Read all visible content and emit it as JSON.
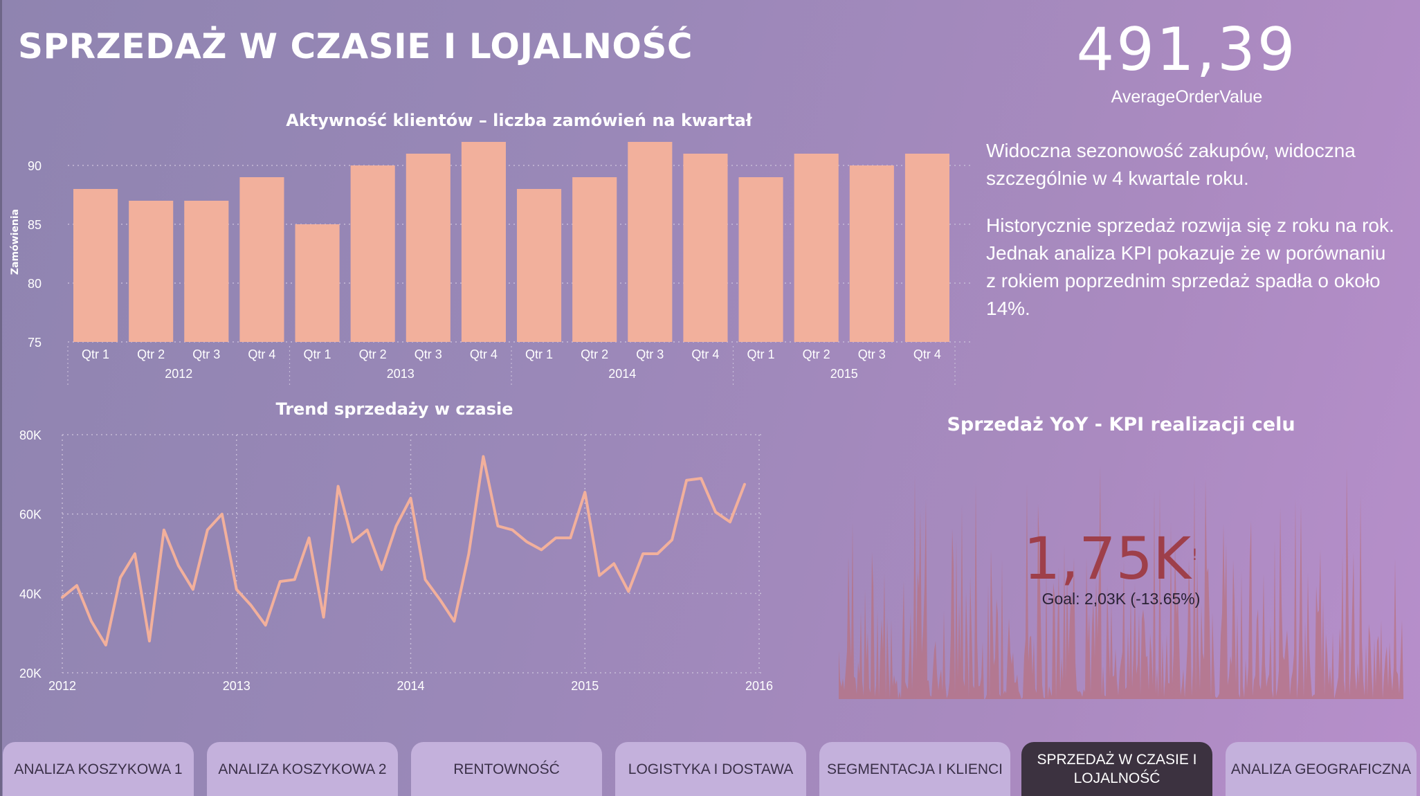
{
  "page": {
    "title": "SPRZEDAŻ W CZASIE I LOJALNOŚĆ"
  },
  "kpi_card": {
    "value": "491,39",
    "label": "AverageOrderValue"
  },
  "insights": {
    "paragraph_1": "Widoczna sezonowość zakupów, widoczna szczególnie w 4 kwartale roku.",
    "paragraph_2": "Historycznie sprzedaż rozwija się z roku na rok. Jednak analiza KPI pokazuje że w porównaniu z rokiem poprzednim sprzedaż spadła o około 14%."
  },
  "kpi_goal_card": {
    "title": "Sprzedaż YoY - KPI realizacji celu",
    "value": "1,75K",
    "indicator": "!",
    "goal_text": "Goal: 2,03K (-13.65%)",
    "value_color": "#9e3f4a"
  },
  "colors": {
    "bar": "#f2b09c",
    "line": "#f2b09c",
    "grid": "#c7bcd8",
    "kpi_area": "#b8707e"
  },
  "chart_data": [
    {
      "type": "bar",
      "title": "Aktywność klientów – liczba zamówień na kwartał",
      "ylabel": "Zamówienia",
      "xlabel": "",
      "ylim": [
        75,
        92
      ],
      "yticks": [
        75,
        80,
        85,
        90
      ],
      "grid": true,
      "categories": [
        "Qtr 1",
        "Qtr 2",
        "Qtr 3",
        "Qtr 4",
        "Qtr 1",
        "Qtr 2",
        "Qtr 3",
        "Qtr 4",
        "Qtr 1",
        "Qtr 2",
        "Qtr 3",
        "Qtr 4",
        "Qtr 1",
        "Qtr 2",
        "Qtr 3",
        "Qtr 4"
      ],
      "groups": [
        {
          "label": "2012",
          "start": 0,
          "count": 4
        },
        {
          "label": "2013",
          "start": 4,
          "count": 4
        },
        {
          "label": "2014",
          "start": 8,
          "count": 4
        },
        {
          "label": "2015",
          "start": 12,
          "count": 4
        }
      ],
      "values": [
        88,
        87,
        87,
        89,
        85,
        90,
        91,
        92,
        88,
        89,
        92,
        91,
        89,
        91,
        90,
        91
      ]
    },
    {
      "type": "line",
      "title": "Trend sprzedaży w czasie",
      "xlabel": "",
      "ylabel": "",
      "xlim": [
        2012,
        2016
      ],
      "xticks": [
        "2012",
        "2013",
        "2014",
        "2015",
        "2016"
      ],
      "ylim": [
        20000,
        80000
      ],
      "yticks": [
        {
          "value": 20000,
          "label": "20K"
        },
        {
          "value": 40000,
          "label": "40K"
        },
        {
          "value": 60000,
          "label": "60K"
        },
        {
          "value": 80000,
          "label": "80K"
        }
      ],
      "grid": true,
      "series": [
        {
          "x": [
            "2012-01",
            "2012-02",
            "2012-03",
            "2012-04",
            "2012-05",
            "2012-06",
            "2012-07",
            "2012-08",
            "2012-09",
            "2012-10",
            "2012-11",
            "2012-12",
            "2013-01",
            "2013-02",
            "2013-03",
            "2013-04",
            "2013-05",
            "2013-06",
            "2013-07",
            "2013-08",
            "2013-09",
            "2013-10",
            "2013-11",
            "2013-12",
            "2014-01",
            "2014-02",
            "2014-03",
            "2014-04",
            "2014-05",
            "2014-06",
            "2014-07",
            "2014-08",
            "2014-09",
            "2014-10",
            "2014-11",
            "2014-12",
            "2015-01",
            "2015-02",
            "2015-03",
            "2015-04",
            "2015-05",
            "2015-06",
            "2015-07",
            "2015-08",
            "2015-09",
            "2015-10",
            "2015-11",
            "2015-12"
          ],
          "values": [
            39000,
            42000,
            33000,
            27000,
            44000,
            50000,
            28000,
            56000,
            47000,
            41000,
            56000,
            60000,
            41000,
            37000,
            32000,
            43000,
            43500,
            54000,
            34000,
            67000,
            53000,
            56000,
            46000,
            57000,
            64000,
            43500,
            38500,
            33000,
            50000,
            74500,
            57000,
            56000,
            53000,
            51000,
            54000,
            54000,
            65500,
            44500,
            47500,
            40500,
            50000,
            50000,
            53500,
            68500,
            69000,
            60500,
            58000,
            67500
          ]
        }
      ]
    }
  ],
  "nav": {
    "buttons": [
      {
        "label": "ANALIZA KOSZYKOWA 1",
        "active": false
      },
      {
        "label": "ANALIZA KOSZYKOWA 2",
        "active": false
      },
      {
        "label": "RENTOWNOŚĆ",
        "active": false
      },
      {
        "label": "LOGISTYKA I DOSTAWA",
        "active": false
      },
      {
        "label": "SEGMENTACJA I KLIENCI",
        "active": false
      },
      {
        "label": "SPRZEDAŻ W CZASIE I LOJALNOŚĆ",
        "active": true
      },
      {
        "label": "ANALIZA GEOGRAFICZNA",
        "active": false
      }
    ]
  }
}
